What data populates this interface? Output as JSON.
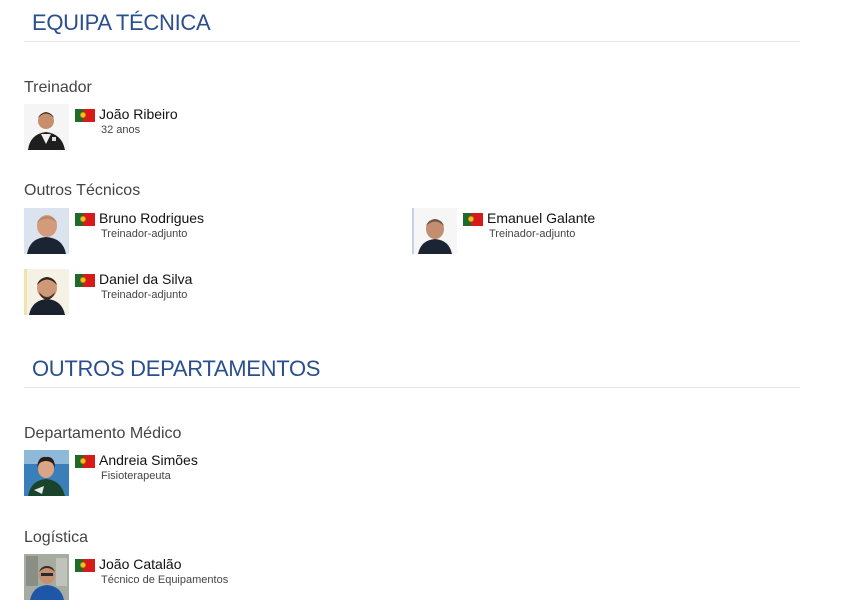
{
  "sections": [
    {
      "title": "EQUIPA TÉCNICA",
      "groups": [
        {
          "label": "Treinador",
          "people": [
            {
              "name": "João Ribeiro",
              "role": "32 anos",
              "flag": "portugal-flag-icon"
            }
          ]
        },
        {
          "label": "Outros Técnicos",
          "people": [
            {
              "name": "Bruno Rodrigues",
              "role": "Treinador-adjunto",
              "flag": "portugal-flag-icon"
            },
            {
              "name": "Emanuel Galante",
              "role": "Treinador-adjunto",
              "flag": "portugal-flag-icon"
            },
            {
              "name": "Daniel da Silva",
              "role": "Treinador-adjunto",
              "flag": "portugal-flag-icon"
            }
          ]
        }
      ]
    },
    {
      "title": "OUTROS DEPARTAMENTOS",
      "groups": [
        {
          "label": "Departamento Médico",
          "people": [
            {
              "name": "Andreia Simões",
              "role": "Fisioterapeuta",
              "flag": "portugal-flag-icon"
            }
          ]
        },
        {
          "label": "Logística",
          "people": [
            {
              "name": "João Catalão",
              "role": "Técnico de Equipamentos",
              "flag": "portugal-flag-icon"
            }
          ]
        }
      ]
    }
  ],
  "colors": {
    "section_title": "#2b4f8e",
    "divider": "#e6e6e6",
    "flag_green": "#1f6b2a",
    "flag_red": "#d71a1a"
  }
}
